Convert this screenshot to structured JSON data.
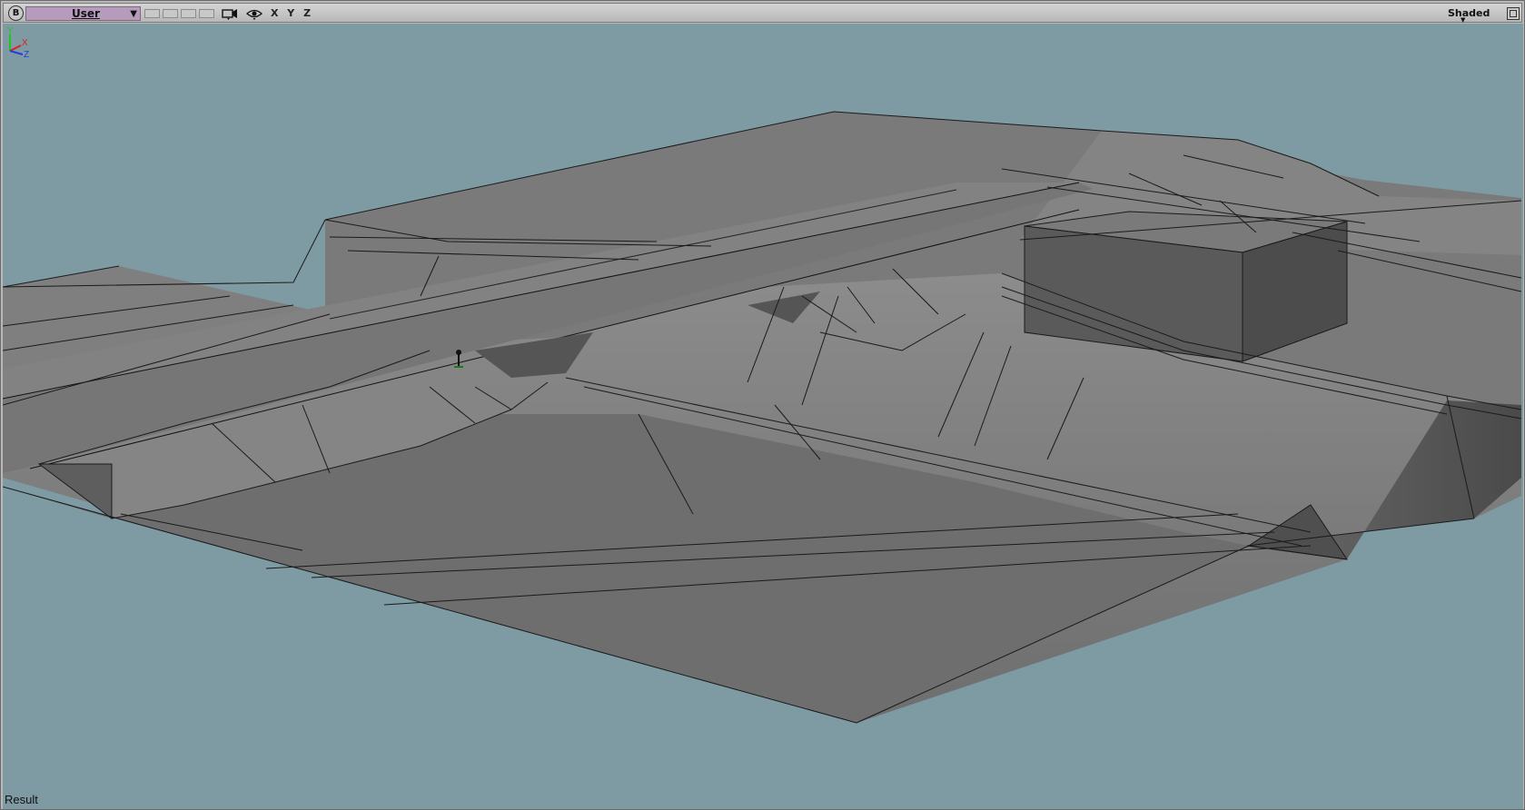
{
  "toolbar": {
    "badge": "B",
    "camera": "User",
    "axes": "X Y Z",
    "shading": "Shaded"
  },
  "icons": {
    "camera": "camera-icon",
    "visibility": "eye-icon",
    "maximize": "maximize-icon",
    "dropdown": "chevron-down-icon"
  },
  "triad": {
    "x": "X",
    "y": "Y",
    "z": "Z"
  },
  "status": {
    "label": "Result"
  },
  "colors": {
    "viewport_bg": "#7e9aa2",
    "toolbar_bg": "#c6c6c6",
    "camera_select": "#b69bbd",
    "mesh_light": "#8a8a8a",
    "mesh_mid": "#747474",
    "mesh_dark": "#5a5a5a"
  }
}
